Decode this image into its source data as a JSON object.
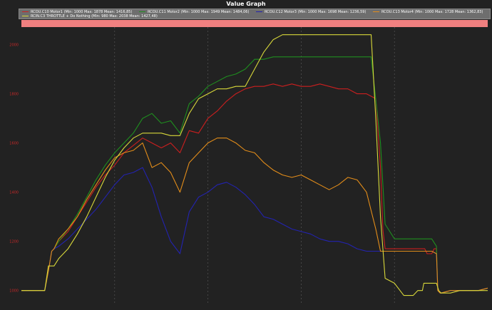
{
  "chart_data": {
    "type": "line",
    "title": "Value Graph",
    "xlabel": "",
    "ylabel": "",
    "ylim": [
      950,
      2100
    ],
    "yticks": [
      1000,
      1200,
      1400,
      1600,
      1800,
      2000
    ],
    "ytick_labels": [
      "1000",
      "1200",
      "1400",
      "1600",
      "1800",
      "2000"
    ],
    "xlim": [
      0,
      100
    ],
    "grid": true,
    "legend_position": "top",
    "colors": {
      "background": "#222222",
      "legend_bg": "#6e6e6e",
      "highlight_band": "#f08080",
      "tick_label": "#c62828",
      "grid": "#555555"
    },
    "legend": [
      {
        "label": "RCOU.C10 Motor1 (Min: 1000 Max: 1878 Mean: 1416,85)",
        "color": "#cc1f1f"
      },
      {
        "label": "RCOU.C11 Motor2 (Min: 1000 Max: 1949 Mean: 1484,06)",
        "color": "#1f8f1f"
      },
      {
        "label": "RCOU.C12 Motor3 (Min: 1000 Max: 1698 Mean: 1236,59)",
        "color": "#2323b0"
      },
      {
        "label": "RCOU.C13 Motor4 (Min: 1000 Max: 1728 Mean: 1362,83)",
        "color": "#e38d1a"
      },
      {
        "label": "RCIN.C3 THROTTLE + Do Nothing (Min: 980 Max: 2038 Mean: 1427,48)",
        "color": "#d8d83a"
      }
    ],
    "series": [
      {
        "name": "RCOU.C10 Motor1",
        "color": "#cc1f1f",
        "x": [
          0,
          5,
          5.8,
          6.5,
          7,
          8,
          10,
          12,
          14,
          16,
          18,
          20,
          22,
          24,
          26,
          28,
          30,
          32,
          34,
          36,
          38,
          40,
          42,
          44,
          46,
          48,
          50,
          52,
          54,
          56,
          58,
          60,
          62,
          64,
          66,
          68,
          70,
          72,
          74,
          76,
          77,
          77.5,
          78,
          80,
          80.5,
          81,
          84,
          85,
          85.5,
          86,
          86.5,
          87,
          88,
          88.5,
          89,
          89.3,
          89.8,
          90,
          92,
          95,
          98,
          100
        ],
        "y": [
          1000,
          1000,
          1080,
          1160,
          1170,
          1200,
          1240,
          1300,
          1360,
          1420,
          1470,
          1510,
          1560,
          1590,
          1620,
          1600,
          1580,
          1600,
          1560,
          1650,
          1640,
          1700,
          1730,
          1770,
          1800,
          1820,
          1830,
          1830,
          1840,
          1830,
          1840,
          1830,
          1830,
          1840,
          1830,
          1820,
          1820,
          1800,
          1800,
          1780,
          1500,
          1250,
          1170,
          1170,
          1170,
          1170,
          1170,
          1170,
          1170,
          1170,
          1170,
          1150,
          1150,
          1170,
          1170,
          1000,
          990,
          990,
          1000,
          1000,
          1000,
          1010
        ]
      },
      {
        "name": "RCOU.C11 Motor2",
        "color": "#1f8f1f",
        "x": [
          0,
          5,
          5.8,
          6.5,
          7,
          8,
          10,
          12,
          14,
          16,
          18,
          20,
          22,
          24,
          26,
          28,
          30,
          32,
          34,
          36,
          38,
          40,
          42,
          44,
          46,
          48,
          50,
          52,
          54,
          56,
          58,
          60,
          62,
          64,
          66,
          68,
          70,
          72,
          74,
          75,
          77,
          78,
          80,
          84,
          85,
          88,
          89,
          89.3,
          89.8,
          90,
          92,
          95,
          98,
          100
        ],
        "y": [
          1000,
          1000,
          1080,
          1160,
          1170,
          1200,
          1250,
          1310,
          1380,
          1450,
          1510,
          1560,
          1600,
          1640,
          1700,
          1720,
          1680,
          1690,
          1640,
          1760,
          1790,
          1830,
          1850,
          1870,
          1880,
          1900,
          1940,
          1940,
          1950,
          1950,
          1950,
          1950,
          1950,
          1950,
          1950,
          1950,
          1950,
          1950,
          1950,
          1950,
          1600,
          1270,
          1210,
          1210,
          1210,
          1210,
          1180,
          1000,
          990,
          990,
          1000,
          1000,
          1000,
          1010
        ]
      },
      {
        "name": "RCOU.C12 Motor3",
        "color": "#2323b0",
        "x": [
          0,
          5,
          5.8,
          6.5,
          7,
          8,
          10,
          12,
          14,
          16,
          18,
          20,
          22,
          24,
          26,
          28,
          30,
          32,
          34,
          36,
          38,
          40,
          42,
          44,
          46,
          48,
          50,
          52,
          54,
          56,
          58,
          60,
          62,
          64,
          66,
          68,
          70,
          72,
          74,
          76,
          77,
          78,
          80,
          84,
          85,
          88,
          89,
          89.3,
          89.8,
          90,
          92,
          95,
          98,
          100
        ],
        "y": [
          1000,
          1000,
          1080,
          1160,
          1170,
          1180,
          1210,
          1250,
          1290,
          1330,
          1380,
          1430,
          1470,
          1480,
          1500,
          1420,
          1300,
          1200,
          1150,
          1320,
          1380,
          1400,
          1430,
          1440,
          1420,
          1390,
          1350,
          1300,
          1290,
          1270,
          1250,
          1240,
          1230,
          1210,
          1200,
          1200,
          1190,
          1170,
          1160,
          1160,
          1160,
          1160,
          1160,
          1160,
          1160,
          1160,
          1150,
          1000,
          990,
          990,
          1000,
          1000,
          1000,
          1010
        ]
      },
      {
        "name": "RCOU.C13 Motor4",
        "color": "#e38d1a",
        "x": [
          0,
          5,
          5.8,
          6.5,
          7,
          8,
          10,
          12,
          14,
          16,
          18,
          20,
          22,
          24,
          26,
          28,
          30,
          32,
          34,
          36,
          38,
          40,
          42,
          44,
          46,
          48,
          50,
          52,
          54,
          56,
          58,
          60,
          62,
          64,
          66,
          68,
          70,
          72,
          74,
          76,
          77,
          78,
          80,
          84,
          85,
          88,
          89,
          89.3,
          89.8,
          90,
          92,
          95,
          98,
          100
        ],
        "y": [
          1000,
          1000,
          1080,
          1160,
          1170,
          1210,
          1250,
          1300,
          1370,
          1430,
          1490,
          1540,
          1560,
          1570,
          1600,
          1500,
          1520,
          1480,
          1400,
          1520,
          1560,
          1600,
          1620,
          1620,
          1600,
          1570,
          1560,
          1520,
          1490,
          1470,
          1460,
          1470,
          1450,
          1430,
          1410,
          1430,
          1460,
          1450,
          1400,
          1250,
          1160,
          1160,
          1160,
          1160,
          1160,
          1160,
          1150,
          1000,
          990,
          990,
          1000,
          1000,
          1000,
          1010
        ]
      },
      {
        "name": "RCIN.C3 THROTTLE + Do Nothing",
        "color": "#d8d83a",
        "x": [
          0,
          5,
          5.8,
          6.5,
          7,
          8,
          10,
          12,
          14,
          16,
          18,
          20,
          22,
          24,
          26,
          28,
          30,
          32,
          34,
          36,
          38,
          40,
          42,
          44,
          46,
          48,
          50,
          52,
          54,
          56,
          58,
          60,
          62,
          64,
          66,
          68,
          70,
          72,
          74,
          75,
          76,
          77,
          78,
          80,
          82,
          84,
          85,
          86,
          86.3,
          86.6,
          87,
          88,
          89,
          89.5,
          90,
          92,
          94,
          96,
          98,
          100
        ],
        "y": [
          1000,
          1000,
          1100,
          1100,
          1100,
          1130,
          1170,
          1230,
          1300,
          1380,
          1460,
          1530,
          1580,
          1620,
          1640,
          1640,
          1640,
          1630,
          1630,
          1720,
          1780,
          1800,
          1820,
          1820,
          1830,
          1830,
          1900,
          1970,
          2020,
          2040,
          2040,
          2040,
          2040,
          2040,
          2040,
          2040,
          2040,
          2040,
          2040,
          2040,
          1700,
          1300,
          1050,
          1030,
          980,
          980,
          1000,
          1000,
          1030,
          1030,
          1030,
          1030,
          1030,
          1000,
          990,
          990,
          1000,
          1000,
          1000,
          1000
        ]
      }
    ]
  }
}
